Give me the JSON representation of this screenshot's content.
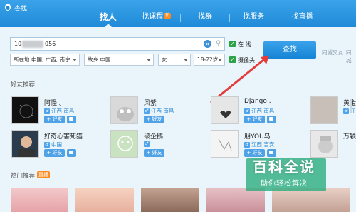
{
  "window": {
    "title": "查找"
  },
  "nav": {
    "tabs": [
      {
        "label": "找人",
        "active": true
      },
      {
        "label": "找课程",
        "badge": "新"
      },
      {
        "label": "找群"
      },
      {
        "label": "找服务"
      },
      {
        "label": "找直播"
      }
    ]
  },
  "search": {
    "keyword_prefix": "10",
    "keyword_suffix": "056",
    "location": "所在地:中国, 广西, 南宁",
    "hometown": "故乡:中国",
    "gender": "女",
    "age": "18-22岁",
    "online_label": "在 线",
    "camera_label": "摄像头",
    "button": "查找",
    "side_link_1": "同城交友",
    "side_link_2": "同城"
  },
  "friends": {
    "title": "好友推荐",
    "add_label": "+ 好友",
    "cards": [
      {
        "name": "阿怪 。",
        "gender": "♂",
        "loc": "江西 南昌",
        "has_msg": true
      },
      {
        "name": "风紫",
        "gender": "",
        "loc": "江西 南昌",
        "has_msg": false
      },
      {
        "name": "Django .",
        "gender": "♂",
        "loc": "江西 南昌",
        "has_msg": true
      },
      {
        "name": "黄金",
        "gender": "",
        "loc": "江西",
        "has_msg": false
      },
      {
        "name": "好奇心害死猫",
        "gender": "",
        "loc": "中国",
        "has_msg": true
      },
      {
        "name": "破企鹅",
        "gender": "",
        "loc": "",
        "has_msg": false
      },
      {
        "name": "朋YOU乌",
        "gender": "♂",
        "loc": "江西 吉安",
        "has_msg": true
      },
      {
        "name": "万颖",
        "gender": "",
        "loc": "",
        "has_msg": false
      }
    ]
  },
  "hot": {
    "title": "热门推荐",
    "badge": "直播"
  },
  "watermark": {
    "big": "百科全说",
    "small": "助你轻松解决"
  },
  "colors": {
    "header": "#1f8ad8",
    "accent": "#50a2e6",
    "arrow": "#e43b3b"
  }
}
